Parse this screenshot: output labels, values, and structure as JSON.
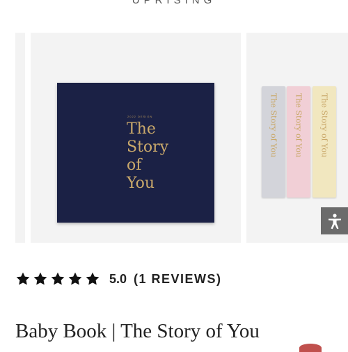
{
  "header": {
    "brand": "UPRISING"
  },
  "carousel": {
    "book_cover": {
      "tag": "2022 DESIGN",
      "title_lines": [
        "The",
        "Story",
        "of",
        "You"
      ]
    },
    "spines": [
      {
        "color": "grey",
        "text": "The Story of You"
      },
      {
        "color": "pink",
        "text": "The Story of You"
      },
      {
        "color": "yellow",
        "text": "The Story of You"
      }
    ]
  },
  "accessibility": {
    "icon": "accessibility-person-icon"
  },
  "rating": {
    "stars": 5,
    "score": "5.0",
    "count_label": "(1 REVIEWS)"
  },
  "product": {
    "title": "Baby Book | The Story of You"
  },
  "colors": {
    "cover_navy": "#1b2145",
    "gold": "#c9a86a",
    "star": "#111111",
    "a11y_bg": "#6b6b6b"
  }
}
